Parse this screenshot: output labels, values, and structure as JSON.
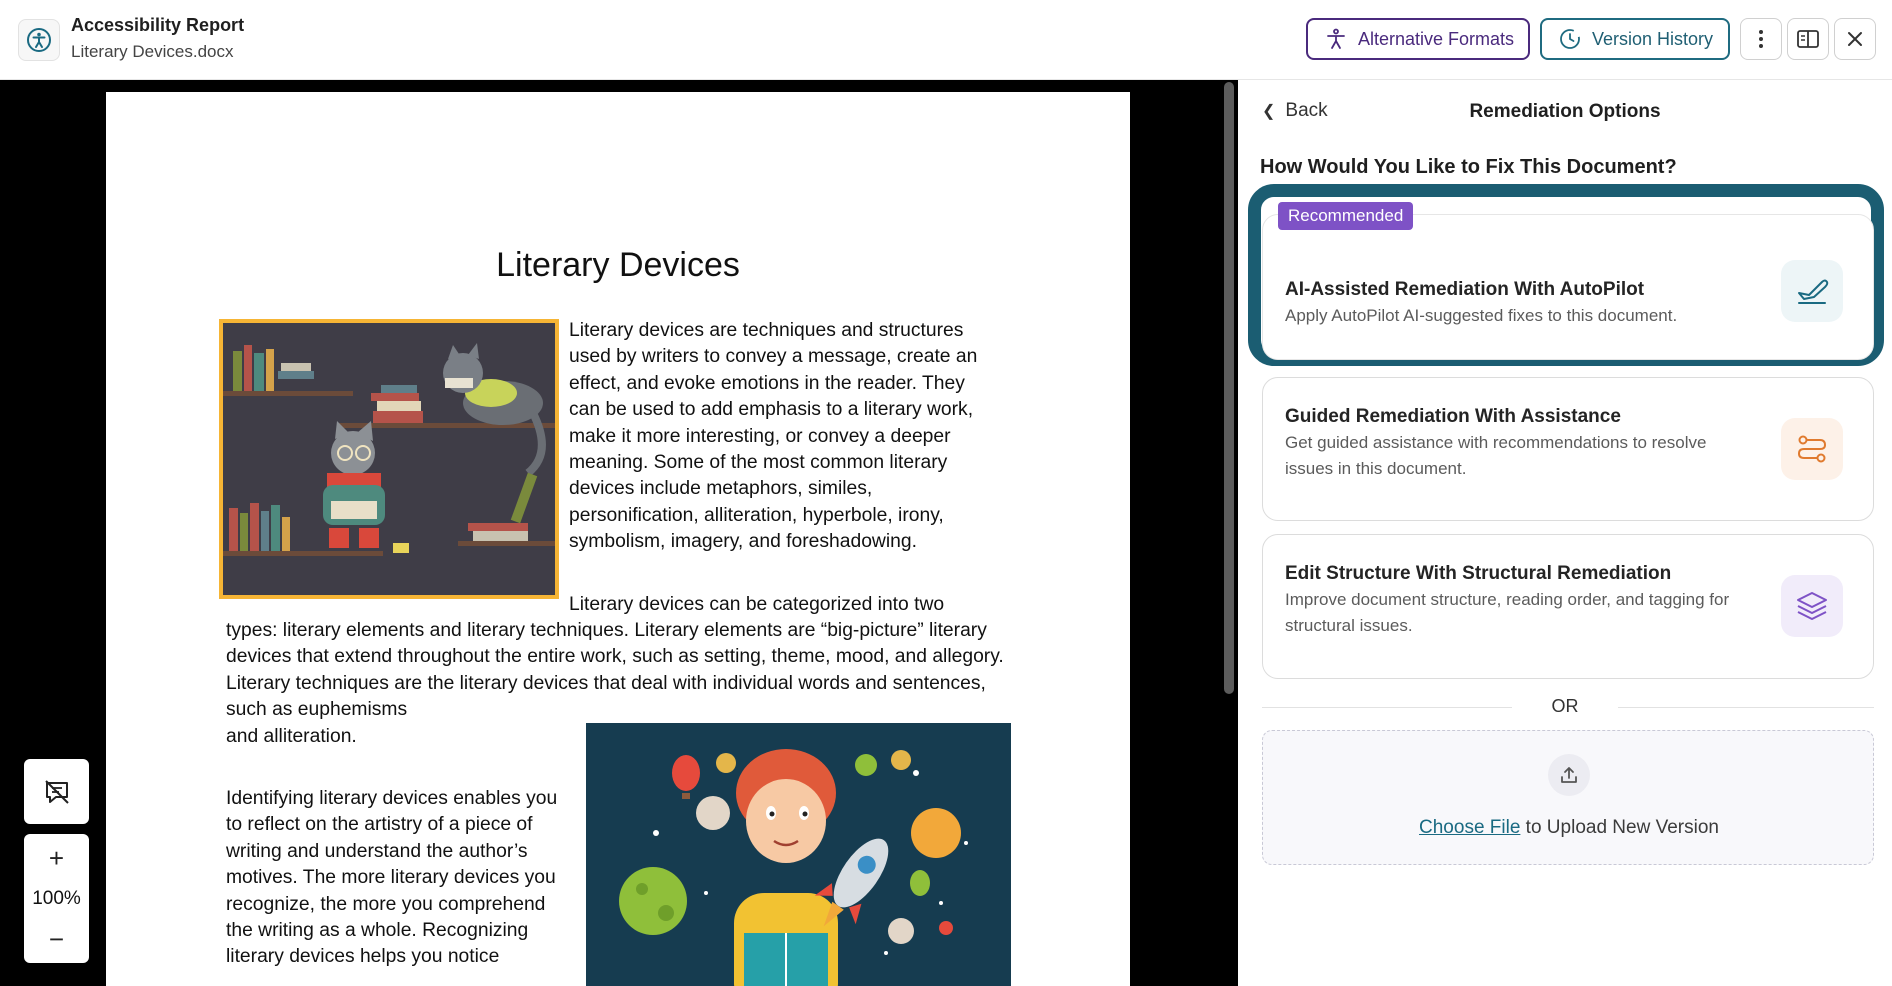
{
  "header": {
    "title": "Accessibility Report",
    "subtitle": "Literary Devices.docx",
    "alt_formats_label": "Alternative Formats",
    "version_history_label": "Version History"
  },
  "document": {
    "title": "Literary Devices",
    "para1": "Literary devices are techniques and structures used by writers to convey a message, create an effect, and evoke emotions in the reader. They can be used to add emphasis to a literary work, make it more interesting, or convey a deeper meaning. Some of the most common literary devices include metaphors, similes, personification, alliteration, hyperbole, irony, symbolism, imagery, and foreshadowing.",
    "para2_first_line": "Literary devices can be categorized into two",
    "para2_rest": "types: literary elements and literary techniques. Literary elements are “big-picture” literary devices that extend throughout the entire work, such as setting, theme, mood, and allegory. Literary techniques are the literary devices that deal with individual words and sentences, such as euphemisms",
    "para2_last": "and alliteration.",
    "para3": "Identifying literary devices enables you to reflect on the artistry of a piece of writing and understand the author’s motives. The more literary devices you recognize, the more you comprehend the writing as a whole. Recognizing literary devices helps you notice"
  },
  "zoom": {
    "level": "100%",
    "in_label": "+",
    "out_label": "−"
  },
  "panel": {
    "back_label": "Back",
    "title": "Remediation Options",
    "question": "How Would You Like to Fix This Document?",
    "options": [
      {
        "badge": "Recommended",
        "title": "AI-Assisted Remediation With AutoPilot",
        "description": "Apply AutoPilot AI-suggested fixes to this document.",
        "icon": "autopilot-plane-icon"
      },
      {
        "title": "Guided Remediation With Assistance",
        "description": "Get guided assistance with recommendations to resolve issues in this document.",
        "icon": "route-icon"
      },
      {
        "title": "Edit Structure With Structural Remediation",
        "description": "Improve document structure, reading order, and tagging for structural issues.",
        "icon": "layers-icon"
      }
    ],
    "or_label": "OR",
    "upload": {
      "link_label": "Choose File",
      "rest_label": " to Upload New Version",
      "icon": "upload-icon"
    }
  },
  "colors": {
    "alt_formats_border": "#4a2a7d",
    "version_history_border": "#1f6b80",
    "recommended_outline": "#1b5d72",
    "badge": "#7e52c6",
    "image_border": "#f6b535"
  }
}
